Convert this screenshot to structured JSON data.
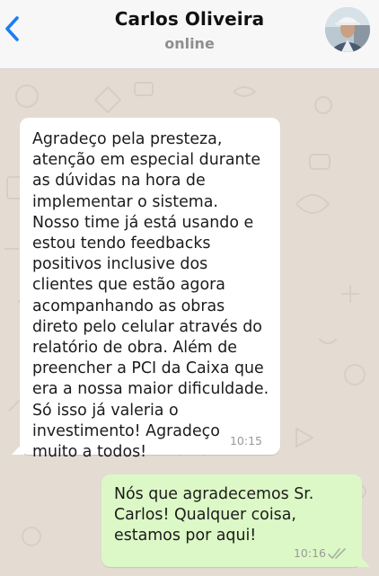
{
  "header": {
    "contact_name": "Carlos Oliveira",
    "status": "online"
  },
  "messages": [
    {
      "direction": "incoming",
      "text": "Agradeço pela presteza, atenção em especial durante as dúvidas na hora de implementar o sistema. Nosso time já está usando e estou tendo feedbacks positivos inclusive dos clientes que estão agora acompanhando as obras direto pelo celular através do relatório de obra. Além de preencher a PCI da Caixa que era a nossa maior dificuldade. Só isso já valeria o investimento! Agradeço muito a todos!",
      "time": "10:15"
    },
    {
      "direction": "outgoing",
      "text": "Nós que agradecemos Sr. Carlos! Qualquer coisa, estamos por aqui!",
      "time": "10:16",
      "read_status_icon": "double-check-icon"
    }
  ],
  "colors": {
    "accent": "#1b7ef5",
    "incoming_bubble": "#ffffff",
    "outgoing_bubble": "#dcf8c6",
    "chat_background": "#e4dcd3"
  },
  "icons": {
    "back": "chevron-left-icon",
    "ticks": "double-check-icon"
  }
}
